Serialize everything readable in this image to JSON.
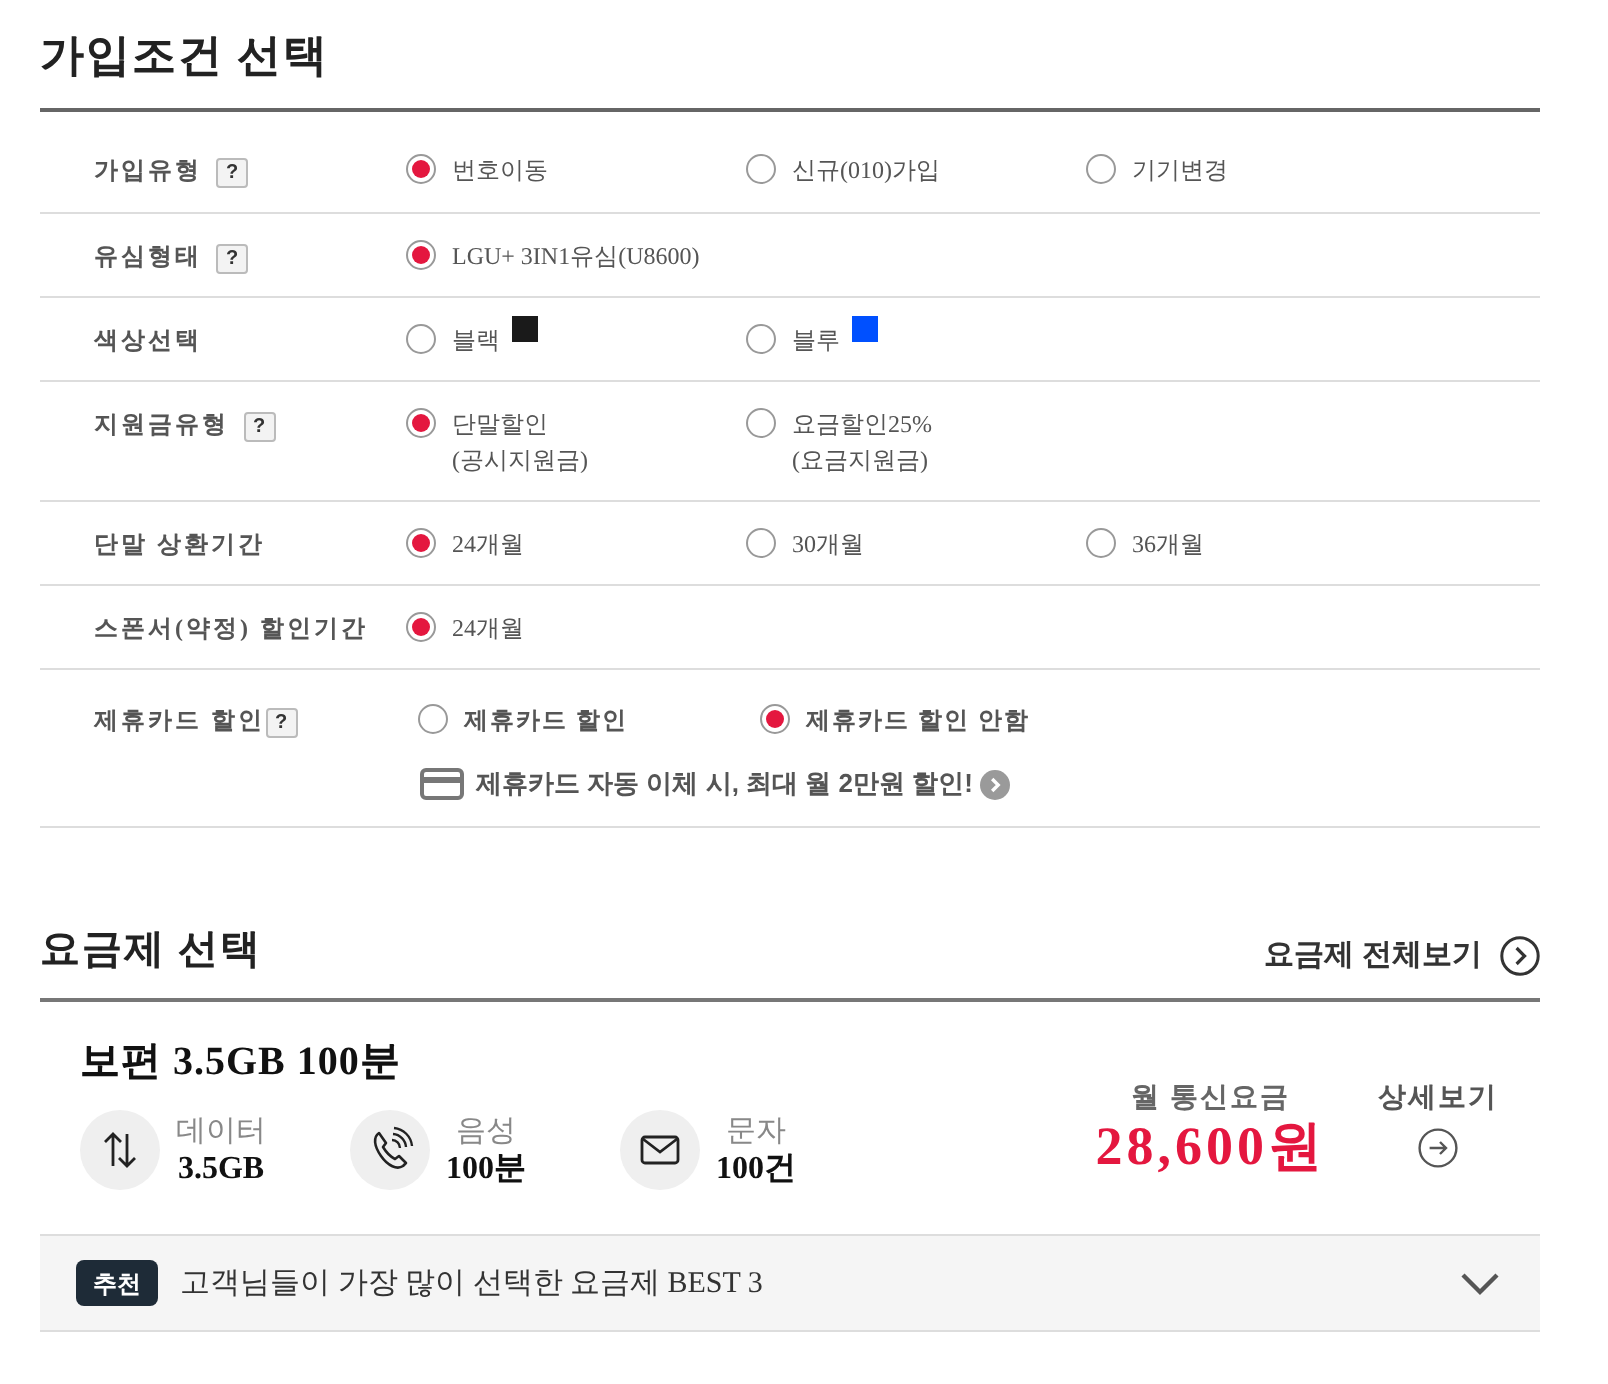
{
  "conditions": {
    "title": "가입조건 선택",
    "rows": [
      {
        "kind": "radio",
        "label": "가입유형",
        "help": "?",
        "options": [
          {
            "label": "번호이동",
            "selected": true
          },
          {
            "label": "신규(010)가입",
            "selected": false
          },
          {
            "label": "기기변경",
            "selected": false
          }
        ]
      },
      {
        "kind": "radio",
        "label": "유심형태",
        "help": "?",
        "options": [
          {
            "label": "LGU+ 3IN1유심(U8600)",
            "selected": true
          }
        ]
      },
      {
        "kind": "radio",
        "label": "색상선택",
        "options": [
          {
            "label": "블랙",
            "selected": false,
            "color": "#1a1a1a"
          },
          {
            "label": "블루",
            "selected": false,
            "color": "#0050ff"
          }
        ]
      },
      {
        "kind": "radio",
        "label": "지원금유형",
        "help": "?",
        "options": [
          {
            "label": "단말할인",
            "note": "(공시지원금)",
            "selected": true
          },
          {
            "label": "요금할인25%",
            "note": "(요금지원금)",
            "selected": false
          }
        ]
      },
      {
        "kind": "radio",
        "label": "단말 상환기간",
        "options": [
          {
            "label": "24개월",
            "selected": true
          },
          {
            "label": "30개월",
            "selected": false
          },
          {
            "label": "36개월",
            "selected": false
          }
        ]
      },
      {
        "kind": "radio",
        "label": "스폰서(약정) 할인기간",
        "options": [
          {
            "label": "24개월",
            "selected": true
          }
        ]
      },
      {
        "kind": "card",
        "label": "제휴카드 할인",
        "help": "?",
        "options": [
          {
            "label": "제휴카드 할인",
            "selected": false
          },
          {
            "label": "제휴카드 할인 안함",
            "selected": true
          }
        ],
        "promo": "제휴카드 자동 이체 시, 최대 월 2만원 할인!"
      }
    ]
  },
  "plans": {
    "title": "요금제 선택",
    "view_all": "요금제 전체보기",
    "plan": {
      "name": "보편 3.5GB 100분",
      "features": [
        {
          "kind": "data",
          "label": "데이터",
          "value": "3.5GB"
        },
        {
          "kind": "voice",
          "label": "음성",
          "value": "100분"
        },
        {
          "kind": "sms",
          "label": "문자",
          "value": "100건"
        }
      ],
      "fee_label": "월 통신요금",
      "fee": "28,600원",
      "details": "상세보기"
    },
    "recommend": {
      "badge": "추천",
      "text": "고객님들이 가장 많이 선택한 요금제 BEST 3",
      "expanded": false
    }
  }
}
